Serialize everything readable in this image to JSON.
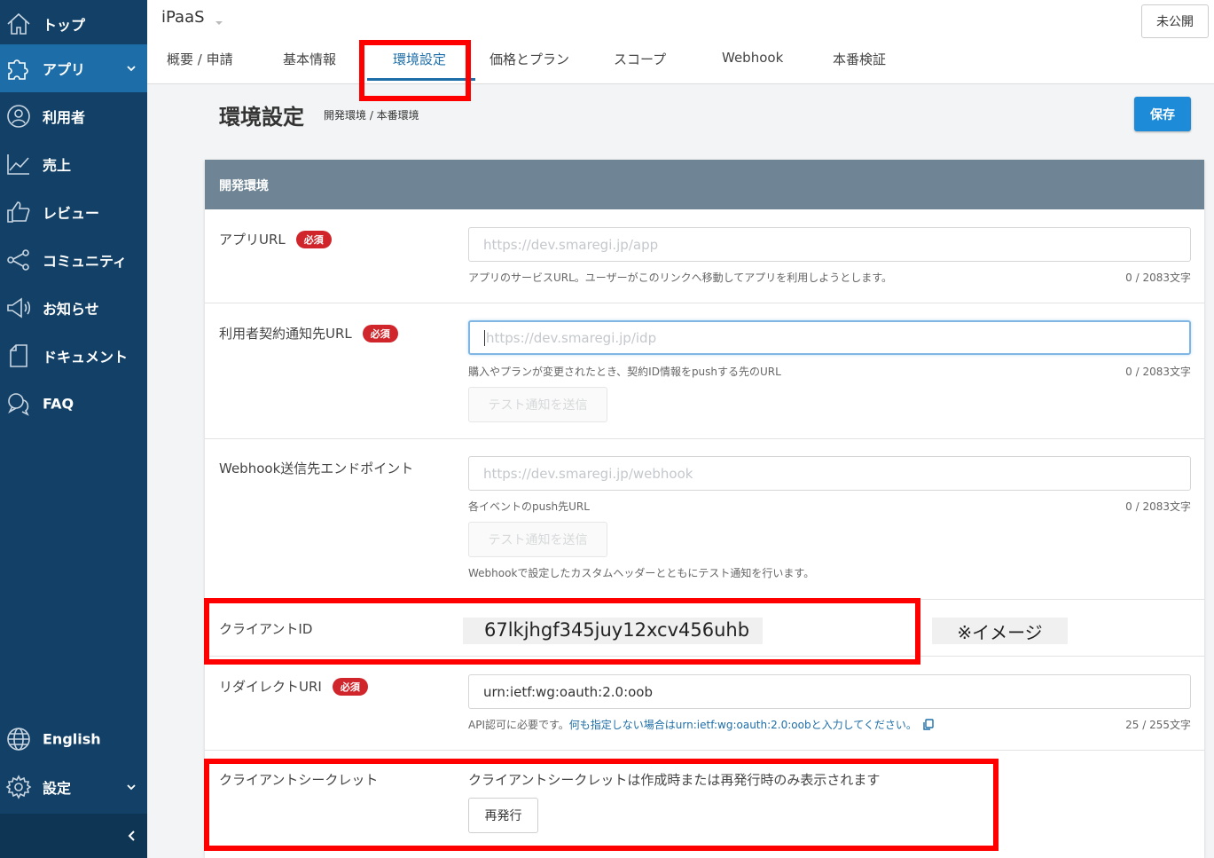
{
  "sidebar": {
    "items": [
      {
        "label": "トップ",
        "icon": "home-icon"
      },
      {
        "label": "アプリ",
        "icon": "puzzle-icon",
        "active": true
      },
      {
        "label": "利用者",
        "icon": "user-icon"
      },
      {
        "label": "売上",
        "icon": "chart-icon"
      },
      {
        "label": "レビュー",
        "icon": "thumbs-up-icon"
      },
      {
        "label": "コミュニティ",
        "icon": "share-icon"
      },
      {
        "label": "お知らせ",
        "icon": "megaphone-icon"
      },
      {
        "label": "ドキュメント",
        "icon": "document-icon"
      },
      {
        "label": "FAQ",
        "icon": "chat-icon"
      }
    ],
    "language": "English",
    "settings": "設定"
  },
  "header": {
    "app_name": "iPaaS",
    "status": "未公開",
    "tabs": [
      "概要 / 申請",
      "基本情報",
      "環境設定",
      "価格とプラン",
      "スコープ",
      "Webhook",
      "本番検証"
    ],
    "active_tab": "環境設定"
  },
  "page": {
    "title": "環境設定",
    "subtitle": "開発環境 / 本番環境",
    "save": "保存"
  },
  "section": {
    "title": "開発環境",
    "required_badge": "必須",
    "app_url": {
      "label": "アプリURL",
      "placeholder": "https://dev.smaregi.jp/app",
      "help": "アプリのサービスURL。ユーザーがこのリンクへ移動してアプリを利用しようとします。",
      "count": "0 / 2083文字"
    },
    "contract_url": {
      "label": "利用者契約通知先URL",
      "placeholder": "https://dev.smaregi.jp/idp",
      "help": "購入やプランが変更されたとき、契約ID情報をpushする先のURL",
      "count": "0 / 2083文字",
      "test_button": "テスト通知を送信"
    },
    "webhook": {
      "label": "Webhook送信先エンドポイント",
      "placeholder": "https://dev.smaregi.jp/webhook",
      "help": "各イベントのpush先URL",
      "count": "0 / 2083文字",
      "test_button": "テスト通知を送信",
      "note": "Webhookで設定したカスタムヘッダーとともにテスト通知を行います。"
    },
    "client_id": {
      "label": "クライアントID",
      "value": "67lkjhgf345juy12xcv456uhb",
      "note": "※イメージ"
    },
    "redirect_uri": {
      "label": "リダイレクトURI",
      "value": "urn:ietf:wg:oauth:2.0:oob",
      "help_prefix": "API認可に必要です。",
      "help_link": "何も指定しない場合はurn:ietf:wg:oauth:2.0:oobと入力してください。",
      "count": "25 / 255文字"
    },
    "client_secret": {
      "label": "クライアントシークレット",
      "note": "クライアントシークレットは作成時または再発行時のみ表示されます",
      "reissue": "再発行"
    }
  },
  "colors": {
    "sidebar_bg": "#124066",
    "sidebar_active": "#1d6ea8",
    "accent": "#1d8bd8",
    "section_header": "#6f8595",
    "required": "#d0262b",
    "highlight": "#ff0000"
  }
}
